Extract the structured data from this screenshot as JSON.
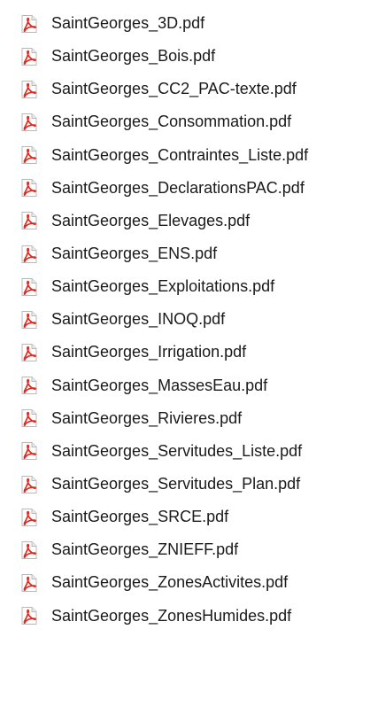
{
  "files": {
    "icon": "pdf-file-icon",
    "accent_color": "#e0281e",
    "items": [
      {
        "name": "SaintGeorges_3D.pdf"
      },
      {
        "name": "SaintGeorges_Bois.pdf"
      },
      {
        "name": "SaintGeorges_CC2_PAC-texte.pdf"
      },
      {
        "name": "SaintGeorges_Consommation.pdf"
      },
      {
        "name": "SaintGeorges_Contraintes_Liste.pdf"
      },
      {
        "name": "SaintGeorges_DeclarationsPAC.pdf"
      },
      {
        "name": "SaintGeorges_Elevages.pdf"
      },
      {
        "name": "SaintGeorges_ENS.pdf"
      },
      {
        "name": "SaintGeorges_Exploitations.pdf"
      },
      {
        "name": "SaintGeorges_INOQ.pdf"
      },
      {
        "name": "SaintGeorges_Irrigation.pdf"
      },
      {
        "name": "SaintGeorges_MassesEau.pdf"
      },
      {
        "name": "SaintGeorges_Rivieres.pdf"
      },
      {
        "name": "SaintGeorges_Servitudes_Liste.pdf"
      },
      {
        "name": "SaintGeorges_Servitudes_Plan.pdf"
      },
      {
        "name": "SaintGeorges_SRCE.pdf"
      },
      {
        "name": "SaintGeorges_ZNIEFF.pdf"
      },
      {
        "name": "SaintGeorges_ZonesActivites.pdf"
      },
      {
        "name": "SaintGeorges_ZonesHumides.pdf"
      }
    ]
  }
}
